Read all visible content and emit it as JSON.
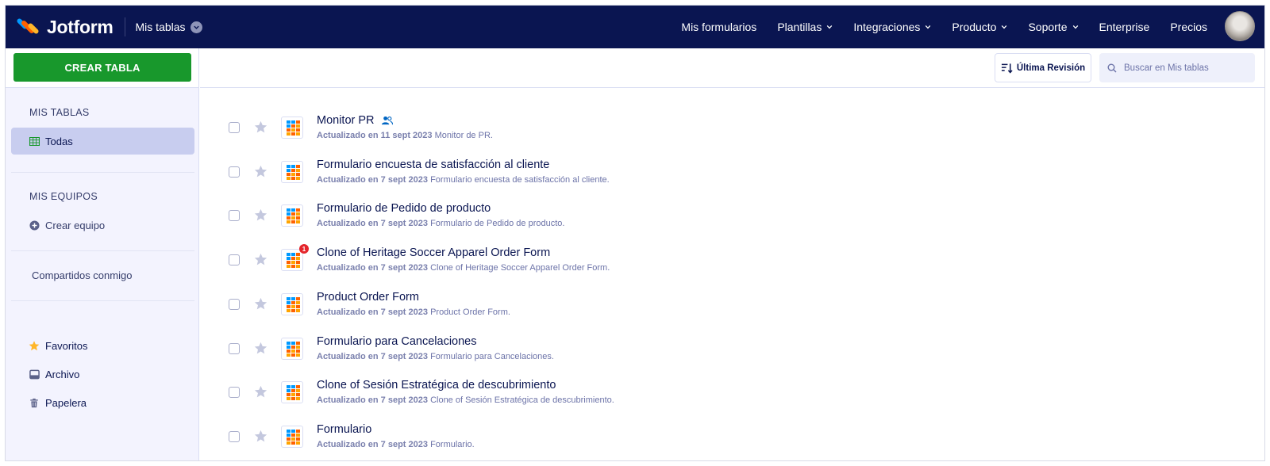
{
  "app": {
    "brand": "Jotform",
    "section": "Mis tablas"
  },
  "nav": {
    "items": [
      {
        "label": "Mis formularios",
        "dropdown": false
      },
      {
        "label": "Plantillas",
        "dropdown": true
      },
      {
        "label": "Integraciones",
        "dropdown": true
      },
      {
        "label": "Producto",
        "dropdown": true
      },
      {
        "label": "Soporte",
        "dropdown": true
      },
      {
        "label": "Enterprise",
        "dropdown": false
      },
      {
        "label": "Precios",
        "dropdown": false
      }
    ]
  },
  "sidebar": {
    "create_label": "CREAR TABLA",
    "my_tables_heading": "MIS TABLAS",
    "all_label": "Todas",
    "my_teams_heading": "MIS EQUIPOS",
    "create_team_label": "Crear equipo",
    "shared_label": "Compartidos conmigo",
    "favorites_label": "Favoritos",
    "archive_label": "Archivo",
    "trash_label": "Papelera"
  },
  "toolbar": {
    "sort_label": "Última Revisión",
    "search_placeholder": "Buscar en Mis tablas"
  },
  "colors": {
    "topbar": "#0a1551",
    "create_button": "#18982c",
    "active_item": "#c8cdef",
    "badge": "#e4242b"
  },
  "tables": [
    {
      "title": "Monitor PR",
      "updated": "Actualizado en 11 sept 2023",
      "desc": "Monitor de PR.",
      "shared": true,
      "badge": ""
    },
    {
      "title": "Formulario encuesta de satisfacción al cliente",
      "updated": "Actualizado en 7 sept 2023",
      "desc": "Formulario encuesta de satisfacción al cliente.",
      "shared": false,
      "badge": ""
    },
    {
      "title": "Formulario de Pedido de producto",
      "updated": "Actualizado en 7 sept 2023",
      "desc": "Formulario de Pedido de producto.",
      "shared": false,
      "badge": ""
    },
    {
      "title": "Clone of Heritage Soccer Apparel Order Form",
      "updated": "Actualizado en 7 sept 2023",
      "desc": "Clone of Heritage Soccer Apparel Order Form.",
      "shared": false,
      "badge": "1"
    },
    {
      "title": "Product Order Form",
      "updated": "Actualizado en 7 sept 2023",
      "desc": "Product Order Form.",
      "shared": false,
      "badge": ""
    },
    {
      "title": "Formulario para Cancelaciones",
      "updated": "Actualizado en 7 sept 2023",
      "desc": "Formulario para Cancelaciones.",
      "shared": false,
      "badge": ""
    },
    {
      "title": "Clone of Sesión Estratégica de descubrimiento",
      "updated": "Actualizado en 7 sept 2023",
      "desc": "Clone of Sesión Estratégica de descubrimiento.",
      "shared": false,
      "badge": ""
    },
    {
      "title": "Formulario",
      "updated": "Actualizado en 7 sept 2023",
      "desc": "Formulario.",
      "shared": false,
      "badge": ""
    }
  ]
}
